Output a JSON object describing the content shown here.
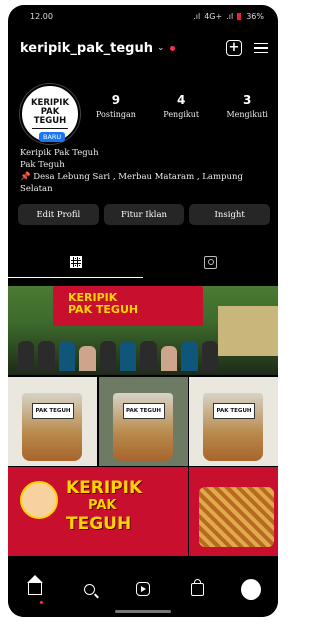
{
  "status_bar": {
    "time": "12.00",
    "network": "4G+",
    "battery": "36%"
  },
  "header": {
    "username": "keripik_pak_teguh"
  },
  "avatar": {
    "logo_line1": "KERIPIK",
    "logo_line2": "PAK",
    "logo_line3": "TEGUH",
    "badge": "BARU"
  },
  "stats": [
    {
      "value": "9",
      "label": "Postingan"
    },
    {
      "value": "4",
      "label": "Pengikut"
    },
    {
      "value": "3",
      "label": "Mengikuti"
    }
  ],
  "bio": {
    "name": "Keripik Pak Teguh",
    "category": "Pak Teguh",
    "location": "📌 Desa Lebung Sari , Merbau Mataram , Lampung Selatan"
  },
  "buttons": {
    "edit_profile": "Edit Profil",
    "ads": "Fitur Iklan",
    "insight": "Insight"
  },
  "posts": {
    "banner_text_1": "KERIPIK",
    "banner_text_2": "PAK TEGUH",
    "bag_label": "PAK TEGUH",
    "promo_line1": "KERIPIK",
    "promo_line2": "PAK",
    "promo_line3": "TEGUH"
  }
}
